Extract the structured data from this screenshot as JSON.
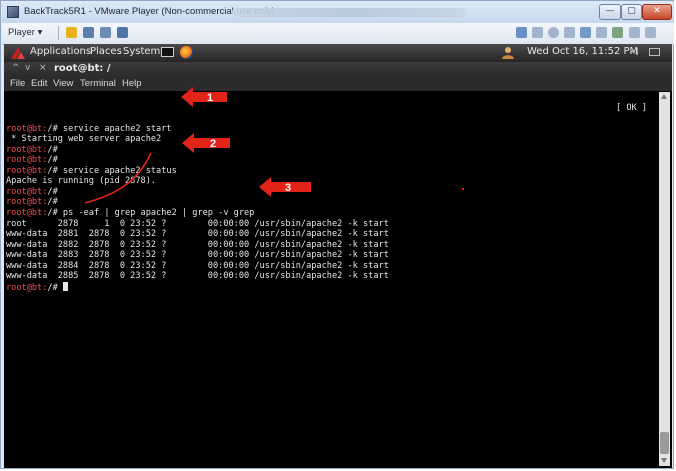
{
  "window": {
    "title": "BackTrack5R1 - VMware Player (Non-commercial use only)",
    "buttons": {
      "minimize": "—",
      "maximize": "▢",
      "close": "✕"
    }
  },
  "vm_toolbar": {
    "player_menu": "Player ▾",
    "icons": [
      "pause-icon",
      "send-ctrl-alt-del-icon",
      "fullscreen-icon",
      "unity-icon"
    ],
    "right_icons": [
      "printer-icon",
      "cd-icon",
      "floppy-icon",
      "network-icon",
      "usb-icon",
      "sound-icon",
      "display-icon",
      "message-icon"
    ]
  },
  "gnome_panel": {
    "menus": [
      "Applications",
      "Places",
      "System"
    ],
    "clock": "Wed Oct 16, 11:52 PM"
  },
  "terminal": {
    "title": "root@bt: /",
    "title_controls": [
      "^",
      "v",
      "×"
    ],
    "menu": [
      "File",
      "Edit",
      "View",
      "Terminal",
      "Help"
    ],
    "prompt": "root@bt:",
    "lines": [
      {
        "prompt": "root@bt:",
        "text": "/# service apache2 start"
      },
      {
        "prompt": "",
        "text": " * Starting web server apache2"
      },
      {
        "prompt": "root@bt:",
        "text": "/#"
      },
      {
        "prompt": "root@bt:",
        "text": "/#"
      },
      {
        "prompt": "root@bt:",
        "text": "/# service apache2 status"
      },
      {
        "prompt": "",
        "text": "Apache is running (pid 2878)."
      },
      {
        "prompt": "root@bt:",
        "text": "/#"
      },
      {
        "prompt": "root@bt:",
        "text": "/#"
      },
      {
        "prompt": "root@bt:",
        "text": "/# ps -eaf | grep apache2 | grep -v grep"
      },
      {
        "prompt": "",
        "text": "root      2878     1  0 23:52 ?        00:00:00 /usr/sbin/apache2 -k start"
      },
      {
        "prompt": "",
        "text": "www-data  2881  2878  0 23:52 ?        00:00:00 /usr/sbin/apache2 -k start"
      },
      {
        "prompt": "",
        "text": "www-data  2882  2878  0 23:52 ?        00:00:00 /usr/sbin/apache2 -k start"
      },
      {
        "prompt": "",
        "text": "www-data  2883  2878  0 23:52 ?        00:00:00 /usr/sbin/apache2 -k start"
      },
      {
        "prompt": "",
        "text": "www-data  2884  2878  0 23:52 ?        00:00:00 /usr/sbin/apache2 -k start"
      },
      {
        "prompt": "",
        "text": "www-data  2885  2878  0 23:52 ?        00:00:00 /usr/sbin/apache2 -k start"
      },
      {
        "prompt": "root@bt:",
        "text": "/# ",
        "cursor": true
      }
    ],
    "ok_status": "[ OK ]"
  },
  "annotations": [
    "1",
    "2",
    "3"
  ],
  "colors": {
    "prompt": "#f04c4c",
    "annotation": "#e2231a",
    "terminal_bg": "#000000",
    "terminal_fg": "#e6e6e6"
  }
}
